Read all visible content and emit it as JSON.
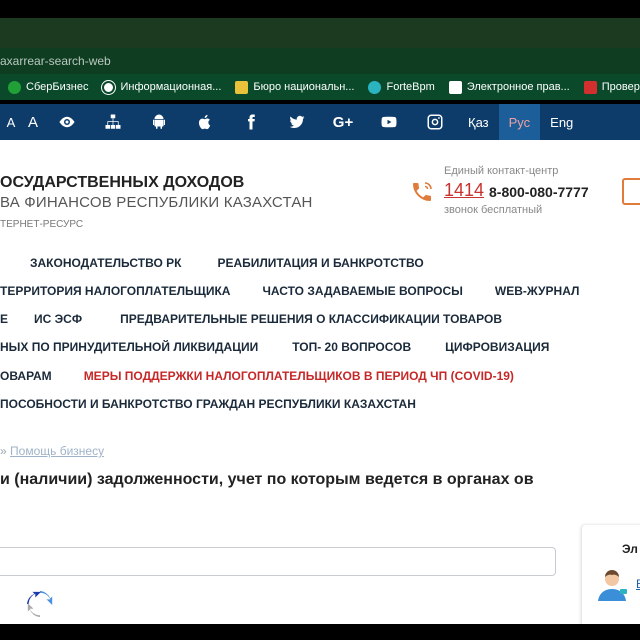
{
  "browser": {
    "url": "axarrear-search-web",
    "bookmarks": [
      {
        "label": "СберБизнес",
        "icon": "sber-icon",
        "color": "#21a038"
      },
      {
        "label": "Информационная...",
        "icon": "globe-icon",
        "color": "#ffffff"
      },
      {
        "label": "Бюро национальн...",
        "icon": "bureau-icon",
        "color": "#e8c23a"
      },
      {
        "label": "ForteBpm",
        "icon": "forte-icon",
        "color": "#2bb3c0"
      },
      {
        "label": "Электронное прав...",
        "icon": "egov-icon",
        "color": "#ffffff"
      },
      {
        "label": "Проверка конт",
        "icon": "check-icon",
        "color": "#d32f2f"
      }
    ]
  },
  "toolbar": {
    "font_small": "А",
    "font_large": "А",
    "icons": [
      "eye-icon",
      "sitemap-icon",
      "android-icon",
      "apple-icon",
      "facebook-icon",
      "twitter-icon",
      "googleplus-icon",
      "youtube-icon",
      "instagram-icon"
    ],
    "googleplus_label": "G+",
    "languages": [
      {
        "label": "Қаз",
        "active": false
      },
      {
        "label": "Рус",
        "active": true
      },
      {
        "label": "Eng",
        "active": false
      }
    ]
  },
  "header": {
    "org_title": "ОСУДАРСТВЕННЫХ ДОХОДОВ",
    "org_subtitle": "ВА ФИНАНСОВ РЕСПУБЛИКИ КАЗАХСТАН",
    "resource": "ТЕРНЕТ-РЕСУРС",
    "contact_label": "Единый контакт-центр",
    "contact_short": "1414",
    "contact_phone": "8-800-080-7777",
    "contact_free": "звонок бесплатный"
  },
  "menu": {
    "row1": [
      "ЗАКОНОДАТЕЛЬСТВО РК",
      "РЕАБИЛИТАЦИЯ И БАНКРОТСТВО"
    ],
    "row2": [
      "ТЕРРИТОРИЯ НАЛОГОПЛАТЕЛЬЩИКА",
      "ЧАСТО ЗАДАВАЕМЫЕ ВОПРОСЫ",
      "WEB-ЖУРНАЛ"
    ],
    "row3": [
      "Е",
      "ИС ЭСФ",
      "ПРЕДВАРИТЕЛЬНЫЕ РЕШЕНИЯ О КЛАССИФИКАЦИИ ТОВАРОВ"
    ],
    "row4": [
      "НЫХ ПО ПРИНУДИТЕЛЬНОЙ ЛИКВИДАЦИИ",
      "ТОП- 20 ВОПРОСОВ",
      "ЦИФРОВИЗАЦИЯ"
    ],
    "row5": [
      "ОВАРАМ",
      "МЕРЫ ПОДДЕРЖКИ НАЛОГОПЛАТЕЛЬЩИКОВ В ПЕРИОД ЧП (COVID-19)"
    ],
    "row6": [
      "ПОСОБНОСТИ И БАНКРОТСТВО ГРАЖДАН РЕСПУБЛИКИ КАЗАХСТАН"
    ]
  },
  "breadcrumb": {
    "separator": "»",
    "link": "Помощь бизнесу"
  },
  "page": {
    "title": "и (наличии) задолженности, учет по которым ведется в органах ов"
  },
  "side_panel": {
    "title": "Эл"
  },
  "colors": {
    "toolbar_bg": "#0d3c6b",
    "active_lang_bg": "#1c5e9a",
    "accent_red": "#c62828",
    "bookmarks_bg": "#0a4a2a"
  }
}
